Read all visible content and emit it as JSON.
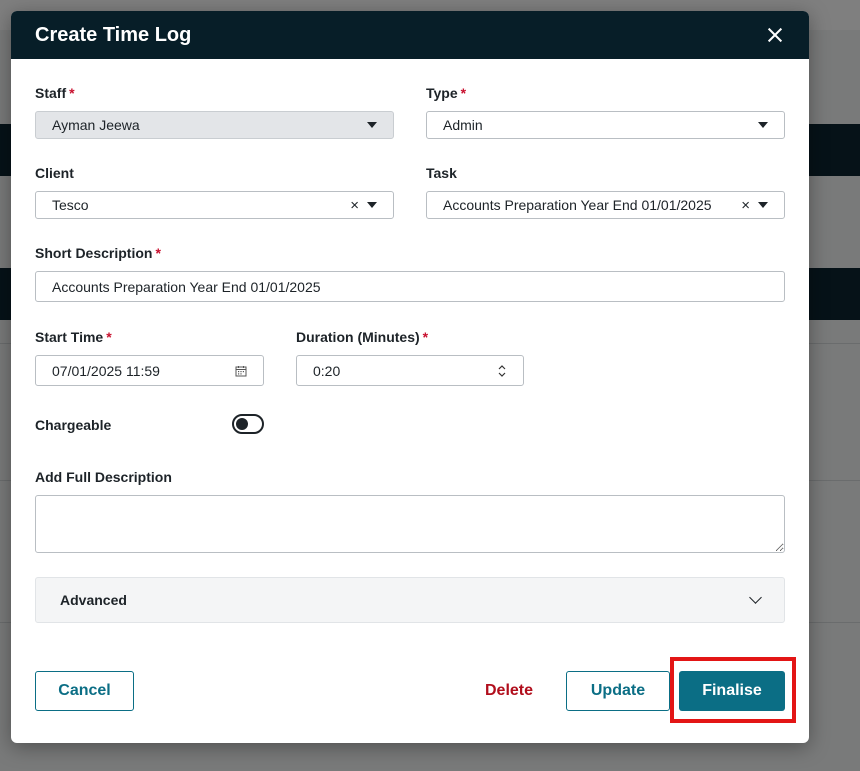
{
  "modal": {
    "title": "Create Time Log",
    "close_icon": "close-icon"
  },
  "fields": {
    "staff": {
      "label": "Staff",
      "required": "*",
      "value": "Ayman Jeewa"
    },
    "type": {
      "label": "Type",
      "required": "*",
      "value": "Admin"
    },
    "client": {
      "label": "Client",
      "value": "Tesco"
    },
    "task": {
      "label": "Task",
      "value": "Accounts Preparation Year End 01/01/2025"
    },
    "short_description": {
      "label": "Short Description",
      "required": "*",
      "value": "Accounts Preparation Year End 01/01/2025"
    },
    "start_time": {
      "label": "Start Time",
      "required": "*",
      "value": "07/01/2025 11:59"
    },
    "duration": {
      "label": "Duration (Minutes)",
      "required": "*",
      "value": "0:20"
    },
    "chargeable": {
      "label": "Chargeable",
      "on": false
    },
    "full_description": {
      "label": "Add Full Description",
      "value": ""
    }
  },
  "accordion": {
    "label": "Advanced"
  },
  "actions": {
    "cancel": "Cancel",
    "delete": "Delete",
    "update": "Update",
    "finalise": "Finalise"
  },
  "colors": {
    "header_bg": "#071e28",
    "primary": "#0b6e85",
    "danger": "#b10e1c",
    "required": "#c8102e",
    "highlight": "#e31515"
  }
}
